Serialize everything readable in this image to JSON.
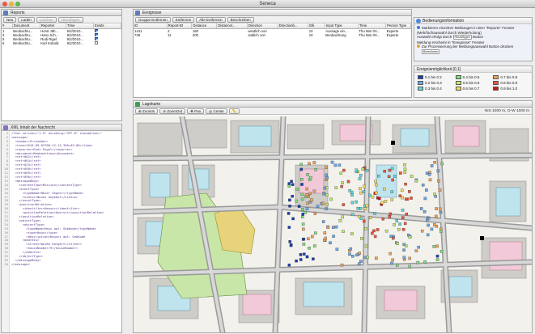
{
  "window": {
    "title": "Seneca"
  },
  "reports": {
    "title": "Reports",
    "toolbar": {
      "new": "Neu",
      "load": "Laden",
      "delete": "Löschen",
      "add": "Hinzufügen"
    },
    "columns": [
      "#",
      "Document",
      "Reporter",
      "Time",
      "Exists"
    ],
    "rows": [
      {
        "num": "1",
        "doc": "Beobachtu...",
        "reporter": "Horst Jäh...",
        "time": "9/2/2010...",
        "exists": true
      },
      {
        "num": "3",
        "doc": "Beobachtu...",
        "reporter": "Hans Sch...",
        "time": "9/2/2010...",
        "exists": true
      },
      {
        "num": "5",
        "doc": "Beobachtu...",
        "reporter": "Rudi Rigel",
        "time": "9/2/2010...",
        "exists": true
      },
      {
        "num": "6",
        "doc": "Beobachtu...",
        "reporter": "Karl Kobold",
        "time": "9/2/2010...",
        "exists": false
      }
    ]
  },
  "xml": {
    "title": "XML Inhalt der Nachricht",
    "lines": [
      "<?xml version=\"1.0\" encoding=\"UTF-8\" standalone=\"",
      "<message>",
      "  <number>5</number>",
      "  <time>2010-09-02T08:12:13.396+02:00</time>",
      "  <reporter>Rudi Rigel</reporter>",
      "  <document>Beobachtung</document>",
      "  <ref>082</ref>",
      "  <ref>064</ref>",
      "  <ref>025</ref>",
      "  <ref>090</ref>",
      "  <ref>069</ref>",
      "  <ref>090</ref>",
      "  <messageBody>",
      "    <contentType>Mission</contentType>",
      "    <eventType>",
      "      <typeName>Neuer Gegner</typeName>",
      "      <status>Neues Angebot</status>",
      "    </eventType>",
      "    <positionRelation>",
      "      <identifier>Hausnr</identifier>",
      "      <positionRelation>Querstr</positionRelation>",
      "    </positionRelation>",
      "    <objectType>",
      "      <objectType>",
      "        <typeName>Haus apt: Gebäude</typeName>",
      "        <type>Haus</type>",
      "        <description>Hausnr apt: Gebäude",
      "      <address>",
      "        <street>Weiße Hofgärt</street>",
      "        <houseNumber>9</houseNumber>",
      "      </address>",
      "    </objectType>",
      "  </messageBody>",
      "</message>"
    ]
  },
  "events": {
    "title": "Ereignisse",
    "toolbar": {
      "remove_group": "Gruppe Entfernen",
      "remove": "Entfernen",
      "remove_all": "Alle Entfernen",
      "describe": "Beschreiben"
    },
    "columns": [
      "ID",
      "Report-ID",
      "Distance",
      "Distancet...",
      "Direction",
      "Directionb...",
      "Elk",
      "Input Type",
      "Time",
      "Person Type"
    ],
    "rows": [
      {
        "id": "1441",
        "report": "2",
        "dist": "180",
        "distt": "",
        "dir": "westlich von",
        "dirb": "",
        "elk": "10",
        "input": "Aussage ein...",
        "time": "Thu Mar 0X...",
        "person": "Experte"
      },
      {
        "id": "739",
        "report": "11",
        "dist": "200",
        "distt": "",
        "dir": "südlich von",
        "dirb": "",
        "elk": "10",
        "input": "Beobachtung",
        "time": "Thu Mar 0X...",
        "person": "Experte"
      }
    ]
  },
  "info": {
    "title": "Bedienungsinformation",
    "line1": "Markieren einzelner Meldungen in dem \"Reports\" Fenster (Mehrfachauswahl durch Wiederholung)",
    "line2": "Auswahl erfolgt durch",
    "line2b": "Button",
    "line3": "Meldung erscheint in \"Ereignisse\" Fenster",
    "line4": "Zur Prozessierung der Meldungsauswahl Button drücken",
    "add_chip": "Hinzufügen",
    "calc_chip": "Berechnen"
  },
  "legend": {
    "title": "Ereignismöglichkeit [0,1]",
    "items": [
      {
        "label": "0.1 bis 0.2",
        "color": "#1a3fb0"
      },
      {
        "label": "0.4 bis 0.5",
        "color": "#7ee07a"
      },
      {
        "label": "0.7 bis 0.8",
        "color": "#f0a25a"
      },
      {
        "label": "0.2 bis 0.3",
        "color": "#6aa8e8"
      },
      {
        "label": "0.5 bis 0.6",
        "color": "#c2e86a"
      },
      {
        "label": "0.8 bis 0.9",
        "color": "#e8553c"
      },
      {
        "label": "0.3 bis 0.4",
        "color": "#5fd8d8"
      },
      {
        "label": "0.6 bis 0.7",
        "color": "#f2dc5a"
      },
      {
        "label": "0.9 bis 1.0",
        "color": "#cc1818"
      }
    ]
  },
  "map": {
    "title": "Lagekarte",
    "toolbar": {
      "zoom_in": "ZoomIn",
      "zoom_out": "ZoomOut",
      "pan": "Pan",
      "center": "Center"
    },
    "coords": "NIS 1000 m, O-W 1000 m"
  }
}
